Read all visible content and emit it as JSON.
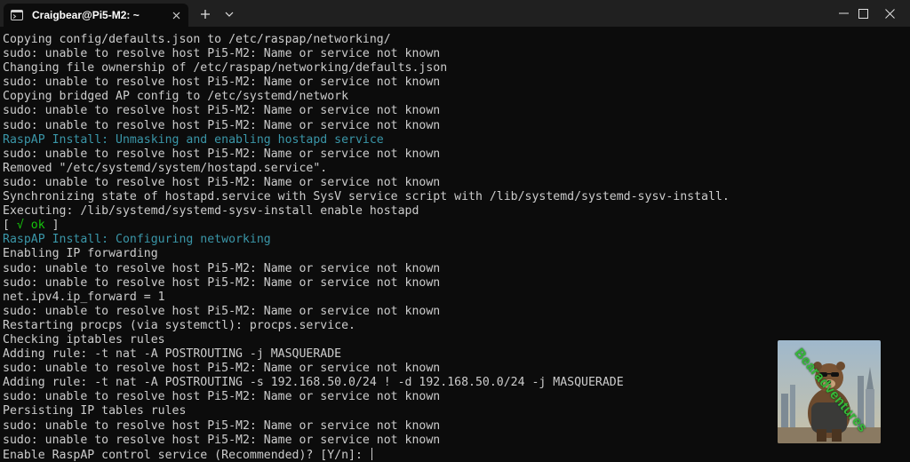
{
  "window": {
    "tab_title": "Craigbear@Pi5-M2: ~",
    "tab_icon": "terminal-icon",
    "buttons": [
      "new-tab-icon",
      "chevron-down-icon",
      "minimize-icon",
      "maximize-icon",
      "close-icon"
    ]
  },
  "colors": {
    "background": "#0c0c0c",
    "text": "#cccccc",
    "accent": "#3a96a8",
    "ok_green": "#16c60c",
    "titlebar": "#202020"
  },
  "terminal": {
    "lines": [
      "Copying config/defaults.json to /etc/raspap/networking/",
      "sudo: unable to resolve host Pi5-M2: Name or service not known",
      "Changing file ownership of /etc/raspap/networking/defaults.json",
      "sudo: unable to resolve host Pi5-M2: Name or service not known",
      "Copying bridged AP config to /etc/systemd/network",
      "sudo: unable to resolve host Pi5-M2: Name or service not known",
      "sudo: unable to resolve host Pi5-M2: Name or service not known",
      "RaspAP Install: Unmasking and enabling hostapd service",
      "sudo: unable to resolve host Pi5-M2: Name or service not known",
      "Removed \"/etc/systemd/system/hostapd.service\".",
      "sudo: unable to resolve host Pi5-M2: Name or service not known",
      "Synchronizing state of hostapd.service with SysV service script with /lib/systemd/systemd-sysv-install.",
      "Executing: /lib/systemd/systemd-sysv-install enable hostapd",
      "",
      "RaspAP Install: Configuring networking",
      "Enabling IP forwarding",
      "sudo: unable to resolve host Pi5-M2: Name or service not known",
      "sudo: unable to resolve host Pi5-M2: Name or service not known",
      "net.ipv4.ip_forward = 1",
      "sudo: unable to resolve host Pi5-M2: Name or service not known",
      "Restarting procps (via systemctl): procps.service.",
      "Checking iptables rules",
      "Adding rule: -t nat -A POSTROUTING -j MASQUERADE",
      "sudo: unable to resolve host Pi5-M2: Name or service not known",
      "Adding rule: -t nat -A POSTROUTING -s 192.168.50.0/24 ! -d 192.168.50.0/24 -j MASQUERADE",
      "sudo: unable to resolve host Pi5-M2: Name or service not known",
      "Persisting IP tables rules",
      "sudo: unable to resolve host Pi5-M2: Name or service not known",
      "sudo: unable to resolve host Pi5-M2: Name or service not known",
      ""
    ],
    "ok_line": {
      "open": "[ ",
      "check": "√ ok",
      "close": " ]"
    },
    "prompt": "Enable RaspAP control service (Recommended)? [Y/n]: "
  },
  "watermark": {
    "text": "Bearadventures"
  }
}
